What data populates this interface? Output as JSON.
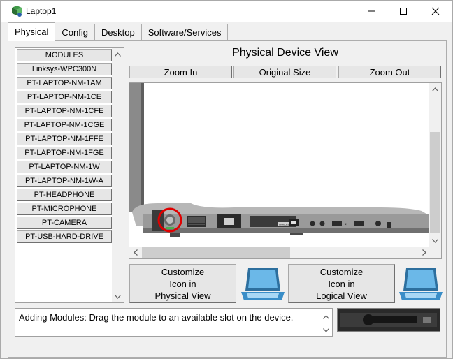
{
  "window": {
    "title": "Laptop1"
  },
  "tabs": [
    {
      "label": "Physical",
      "active": true
    },
    {
      "label": "Config",
      "active": false
    },
    {
      "label": "Desktop",
      "active": false
    },
    {
      "label": "Software/Services",
      "active": false
    }
  ],
  "modules": [
    "MODULES",
    "Linksys-WPC300N",
    "PT-LAPTOP-NM-1AM",
    "PT-LAPTOP-NM-1CE",
    "PT-LAPTOP-NM-1CFE",
    "PT-LAPTOP-NM-1CGE",
    "PT-LAPTOP-NM-1FFE",
    "PT-LAPTOP-NM-1FGE",
    "PT-LAPTOP-NM-1W",
    "PT-LAPTOP-NM-1W-A",
    "PT-HEADPHONE",
    "PT-MICROPHONE",
    "PT-CAMERA",
    "PT-USB-HARD-DRIVE"
  ],
  "device_view": {
    "title": "Physical Device View",
    "zoom_in": "Zoom In",
    "original_size": "Original Size",
    "zoom_out": "Zoom Out",
    "port_label": "WIRELESS"
  },
  "customize": {
    "physical": "Customize\nIcon in\nPhysical View",
    "logical": "Customize\nIcon in\nLogical View"
  },
  "info_text": "Adding Modules: Drag the module to an available slot on the device.",
  "colors": {
    "highlight_circle": "#e00000",
    "laptop_icon": "#3a8ec8"
  }
}
